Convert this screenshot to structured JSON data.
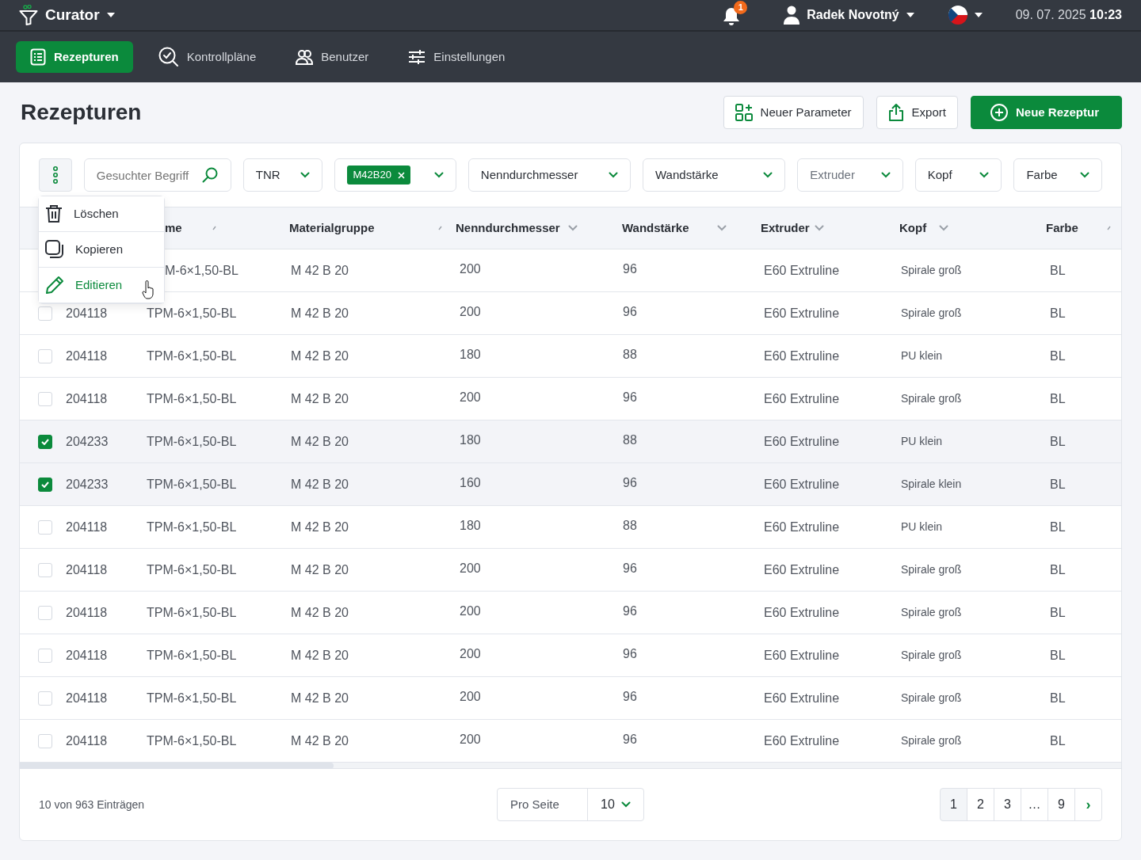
{
  "app": {
    "title": "Curator",
    "notifications": "1",
    "user": "Radek Novotný",
    "datetime": "09. 07. 2025 **10:23**"
  },
  "nav": [
    {
      "label": "Rezepturen",
      "selected": true
    },
    {
      "label": "Kontrollpläne",
      "selected": false
    },
    {
      "label": "Benutzer",
      "selected": false
    },
    {
      "label": "Einstellungen",
      "selected": false
    }
  ],
  "page": {
    "title": "Rezepturen",
    "actions": [
      {
        "label": "Neuer Parameter",
        "kind": "outline"
      },
      {
        "label": "Export",
        "kind": "outline"
      },
      {
        "label": "Neue Rezeptur",
        "kind": "primary"
      }
    ]
  },
  "filters": {
    "search": {
      "placeholder": "Gesuchter Begriff"
    },
    "selects": [
      {
        "kind": "select",
        "label": "TNR",
        "muted": false
      },
      {
        "kind": "tags",
        "tags": [
          "M42B20"
        ]
      },
      {
        "kind": "select",
        "label": "Nenndurchmesser",
        "muted": false
      },
      {
        "kind": "select",
        "label": "Wandstärke",
        "muted": false
      },
      {
        "kind": "select",
        "label": "Extruder",
        "muted": true
      },
      {
        "kind": "select",
        "label": "Kopf",
        "muted": false
      },
      {
        "kind": "select",
        "label": "Farbe",
        "muted": false
      }
    ]
  },
  "menu": [
    {
      "label": "Löschen",
      "highlighted": false
    },
    {
      "label": "Kopieren",
      "highlighted": false
    },
    {
      "label": "Editieren",
      "highlighted": true
    }
  ],
  "table": {
    "columns": [
      "",
      "me",
      "Materialgruppe",
      "Nenndurchmesser",
      "Wandstärke",
      "Extruder",
      "Kopf",
      "Farbe"
    ],
    "rows": [
      {
        "selected": false,
        "cells": [
          "",
          "M-6×1,50-BL",
          "M 42 B 20",
          "200",
          "96",
          "E60 Extruline",
          "Spirale groß",
          "BL"
        ]
      },
      {
        "selected": false,
        "cells": [
          "204118",
          "TPM-6×1,50-BL",
          "M 42 B 20",
          "200",
          "96",
          "E60 Extruline",
          "Spirale groß",
          "BL"
        ]
      },
      {
        "selected": false,
        "cells": [
          "204118",
          "TPM-6×1,50-BL",
          "M 42 B 20",
          "180",
          "88",
          "E60 Extruline",
          "PU klein",
          "BL"
        ]
      },
      {
        "selected": false,
        "cells": [
          "204118",
          "TPM-6×1,50-BL",
          "M 42 B 20",
          "200",
          "96",
          "E60 Extruline",
          "Spirale groß",
          "BL"
        ]
      },
      {
        "selected": true,
        "cells": [
          "204233",
          "TPM-6×1,50-BL",
          "M 42 B 20",
          "180",
          "88",
          "E60 Extruline",
          "PU klein",
          "BL"
        ]
      },
      {
        "selected": true,
        "cells": [
          "204233",
          "TPM-6×1,50-BL",
          "M 42 B 20",
          "160",
          "96",
          "E60 Extruline",
          "Spirale klein",
          "BL"
        ]
      },
      {
        "selected": false,
        "cells": [
          "204118",
          "TPM-6×1,50-BL",
          "M 42 B 20",
          "180",
          "88",
          "E60 Extruline",
          "PU klein",
          "BL"
        ]
      },
      {
        "selected": false,
        "cells": [
          "204118",
          "TPM-6×1,50-BL",
          "M 42 B 20",
          "200",
          "96",
          "E60 Extruline",
          "Spirale groß",
          "BL"
        ]
      },
      {
        "selected": false,
        "cells": [
          "204118",
          "TPM-6×1,50-BL",
          "M 42 B 20",
          "200",
          "96",
          "E60 Extruline",
          "Spirale groß",
          "BL"
        ]
      },
      {
        "selected": false,
        "cells": [
          "204118",
          "TPM-6×1,50-BL",
          "M 42 B 20",
          "200",
          "96",
          "E60 Extruline",
          "Spirale groß",
          "BL"
        ]
      },
      {
        "selected": false,
        "cells": [
          "204118",
          "TPM-6×1,50-BL",
          "M 42 B 20",
          "200",
          "96",
          "E60 Extruline",
          "Spirale groß",
          "BL"
        ]
      },
      {
        "selected": false,
        "cells": [
          "204118",
          "TPM-6×1,50-BL",
          "M 42 B 20",
          "200",
          "96",
          "E60 Extruline",
          "Spirale groß",
          "BL"
        ]
      }
    ]
  },
  "footer": {
    "summary": "10 von 963 Einträgen",
    "per_page_label": "Pro Seite",
    "per_page": "10",
    "pages": [
      {
        "label": "1",
        "selected": true
      },
      {
        "label": "2",
        "selected": false
      },
      {
        "label": "3",
        "selected": false
      },
      {
        "label": "…",
        "selected": false
      },
      {
        "label": "9",
        "selected": false
      }
    ],
    "next": "›"
  }
}
